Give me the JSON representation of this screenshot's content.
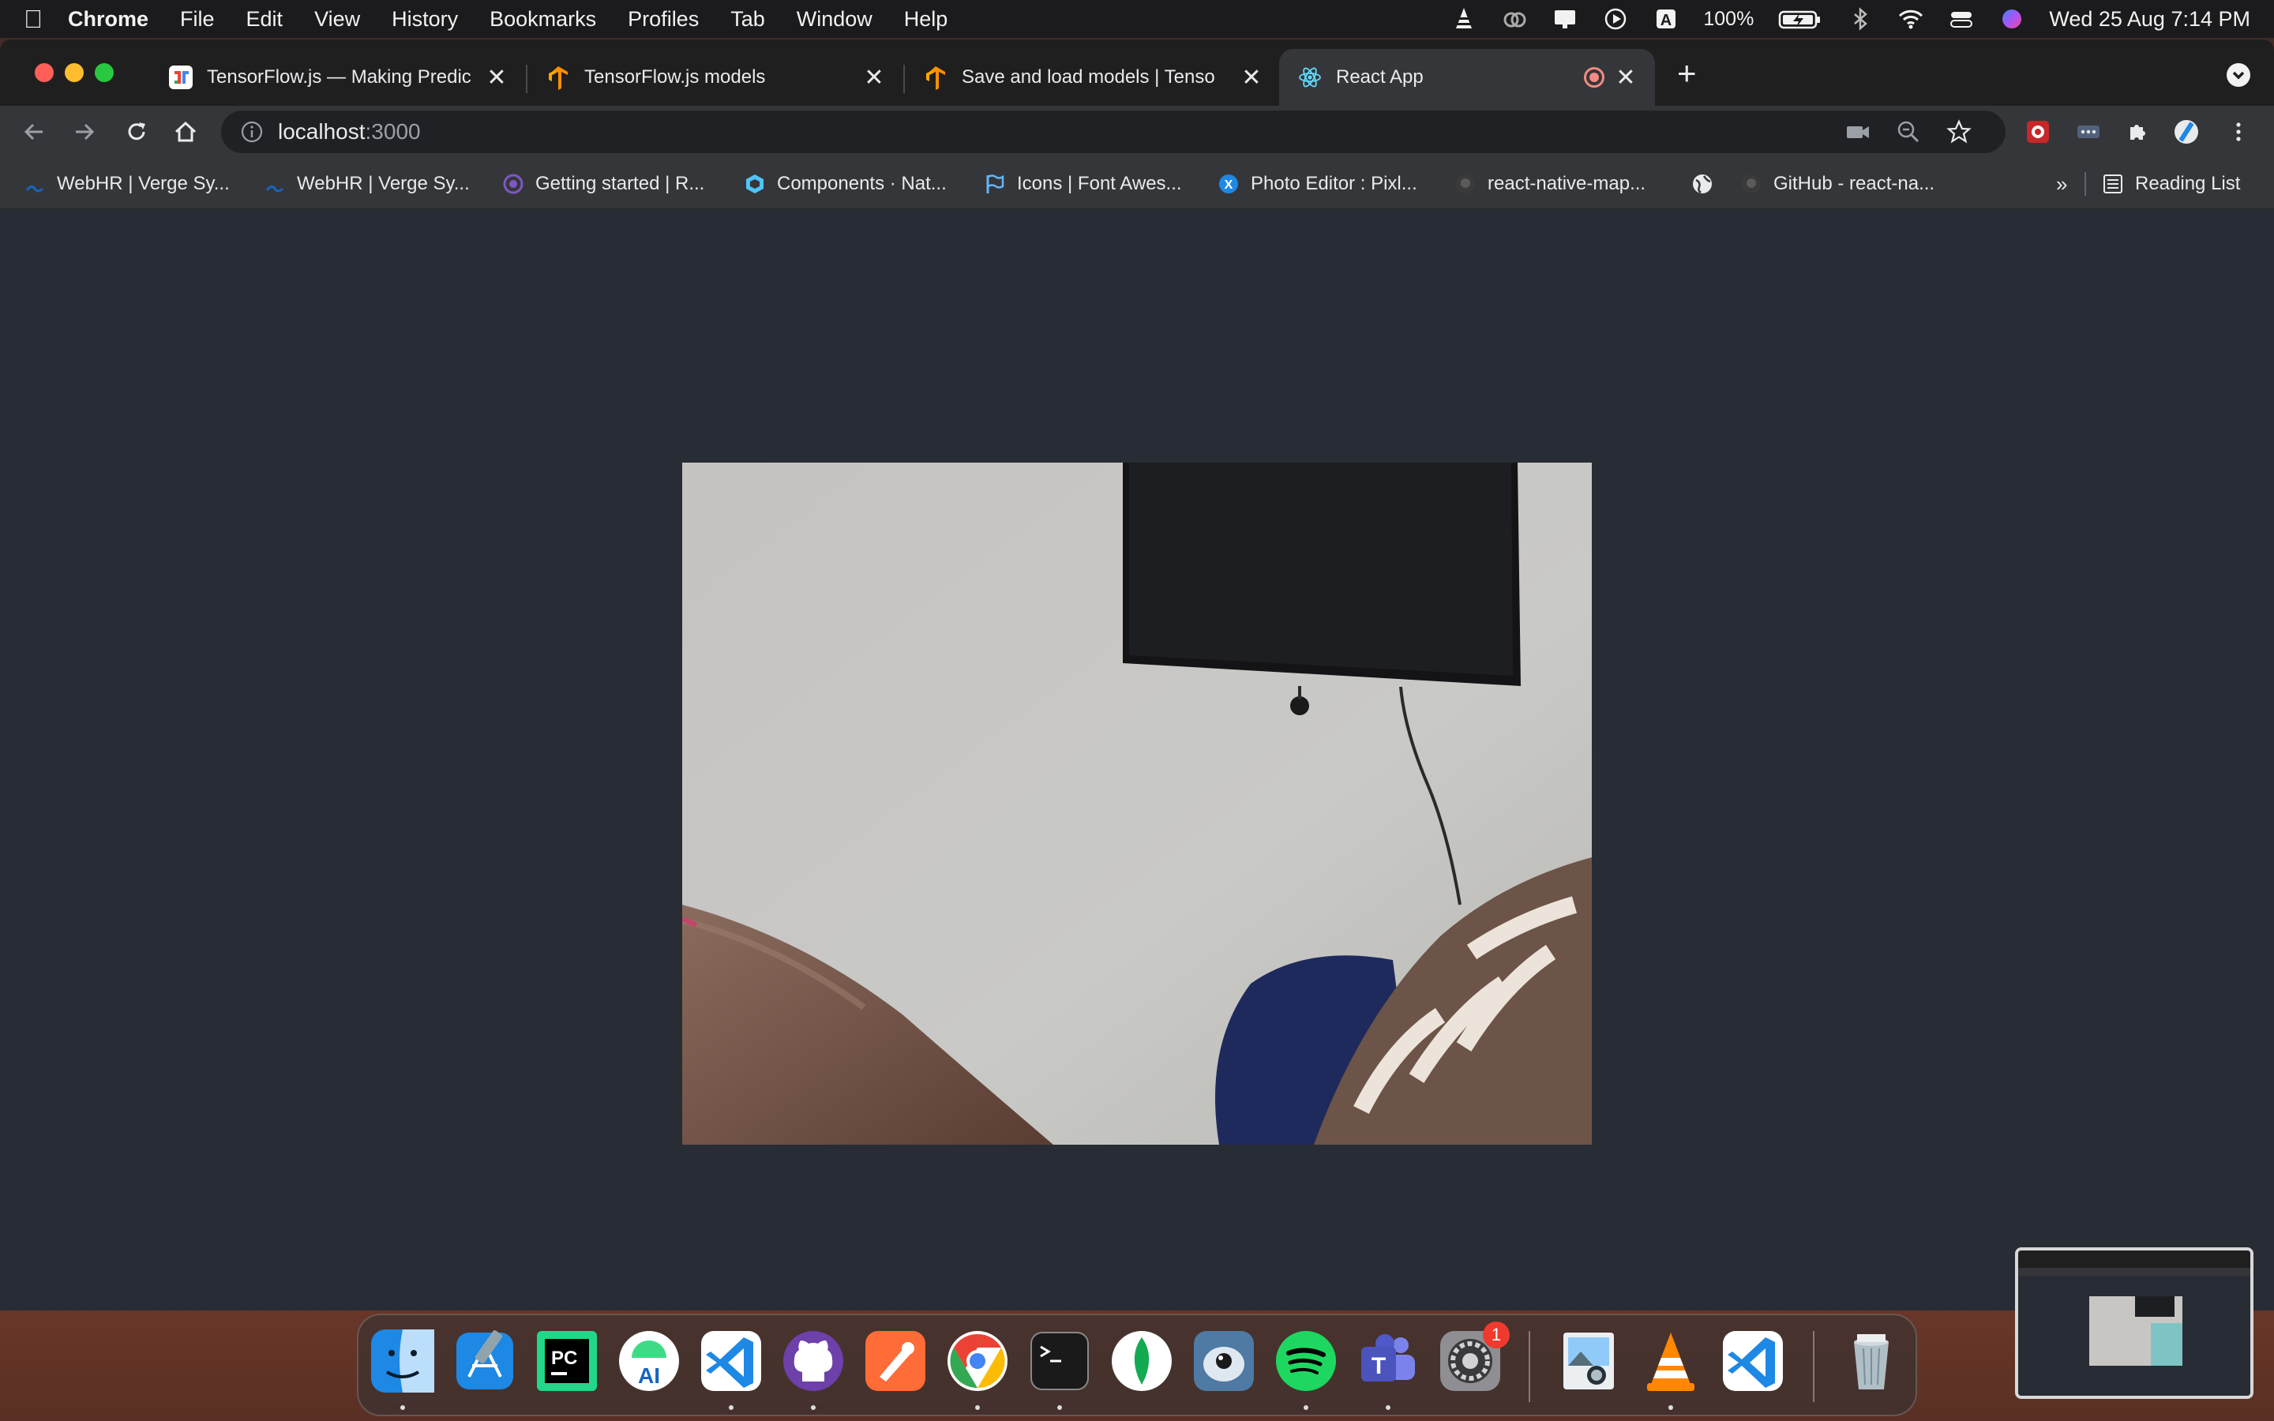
{
  "menubar": {
    "app_name": "Chrome",
    "items": [
      "File",
      "Edit",
      "View",
      "History",
      "Bookmarks",
      "Profiles",
      "Tab",
      "Window",
      "Help"
    ],
    "battery": "100%",
    "clock": "Wed 25 Aug  7:14 PM",
    "status_icons": [
      "vlc-icon",
      "creative-cloud-icon",
      "display-icon",
      "play-icon",
      "input-source-icon",
      "battery-icon",
      "bluetooth-icon",
      "wifi-icon",
      "control-center-icon",
      "siri-icon"
    ],
    "input_source": "A"
  },
  "tabs": [
    {
      "label": "TensorFlow.js — Making Predic",
      "icon": "tfjs-favicon",
      "active": false
    },
    {
      "label": "TensorFlow.js models",
      "icon": "tensorflow-favicon",
      "active": false
    },
    {
      "label": "Save and load models  |  Tenso",
      "icon": "tensorflow-favicon",
      "active": false
    },
    {
      "label": "React App",
      "icon": "react-favicon",
      "active": true
    }
  ],
  "omnibox": {
    "host": "localhost",
    "port": ":3000"
  },
  "bookmarks": [
    {
      "label": "WebHR | Verge Sy...",
      "icon": "webhr-favicon"
    },
    {
      "label": "WebHR | Verge Sy...",
      "icon": "webhr-favicon"
    },
    {
      "label": "Getting started | R...",
      "icon": "expo-favicon"
    },
    {
      "label": "Components · Nat...",
      "icon": "native-base-favicon"
    },
    {
      "label": "Icons | Font Awes...",
      "icon": "font-awesome-favicon"
    },
    {
      "label": "Photo Editor : Pixl...",
      "icon": "pixlr-favicon"
    },
    {
      "label": "react-native-map...",
      "icon": "github-favicon"
    },
    {
      "label": "",
      "icon": "globe-favicon"
    },
    {
      "label": "GitHub - react-na...",
      "icon": "github-favicon"
    }
  ],
  "bookmarks_overflow": "»",
  "reading_list": "Reading List",
  "dock": {
    "apps": [
      "Finder",
      "Xcode",
      "PyCharm",
      "Android Studio",
      "Visual Studio Code",
      "GitHub Desktop",
      "Postman",
      "Google Chrome",
      "Terminal",
      "MongoDB Compass",
      "Tweetbot",
      "Spotify",
      "Microsoft Teams",
      "System Preferences",
      "Preview",
      "VLC",
      "Visual Studio Code",
      "Trash"
    ],
    "settings_badge": "1"
  },
  "colors": {
    "page_bg": "#282c34",
    "tab_active": "#35363a",
    "tabstrip": "#1f1f1f",
    "recording_dot": "#f28b82"
  }
}
